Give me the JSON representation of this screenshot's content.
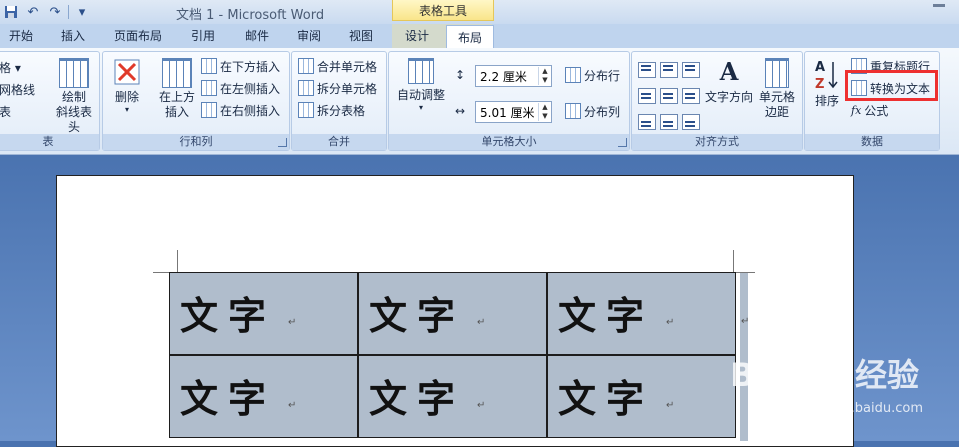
{
  "window": {
    "title": "文档 1 - Microsoft Word",
    "context_tab": "表格工具"
  },
  "qat": [
    "save-icon",
    "undo-icon",
    "redo-icon",
    "customize-icon"
  ],
  "tabs": [
    "开始",
    "插入",
    "页面布局",
    "引用",
    "邮件",
    "审阅",
    "视图",
    "设计",
    "布局"
  ],
  "active_tab": "布局",
  "ribbon": {
    "table_group": {
      "label": "表",
      "gridlines_partial": "网格线",
      "draw_diagonal": "绘制\n斜线表头",
      "partial_top": "格 ▾",
      "partial_mid": "表"
    },
    "rows_cols_group": {
      "label": "行和列",
      "delete": "删除",
      "insert_above": "在上方\n插入",
      "insert_below": "在下方插入",
      "insert_left": "在左侧插入",
      "insert_right": "在右侧插入"
    },
    "merge_group": {
      "label": "合并",
      "merge_cells": "合并单元格",
      "split_cells": "拆分单元格",
      "split_table": "拆分表格"
    },
    "cell_size_group": {
      "label": "单元格大小",
      "autofit": "自动调整",
      "height_value": "2.2 厘米",
      "width_value": "5.01 厘米",
      "distribute_rows": "分布行",
      "distribute_cols": "分布列"
    },
    "alignment_group": {
      "label": "对齐方式",
      "text_direction": "文字方向",
      "cell_margins": "单元格\n边距"
    },
    "data_group": {
      "label": "数据",
      "sort": "排序",
      "repeat_header": "重复标题行",
      "convert_to_text": "转换为文本",
      "formula": "公式"
    }
  },
  "document": {
    "cells": [
      [
        "文字",
        "文字",
        "文字"
      ],
      [
        "文字",
        "文字",
        "文字"
      ]
    ],
    "paragraph_mark": "↵"
  },
  "watermark": {
    "logo": "Bai du 经验",
    "url": "jingyan.baidu.com"
  },
  "colors": {
    "highlight": "#ee3030",
    "cell_shading": "#b0bdcc",
    "ribbon_blue": "#c6d8ef"
  }
}
